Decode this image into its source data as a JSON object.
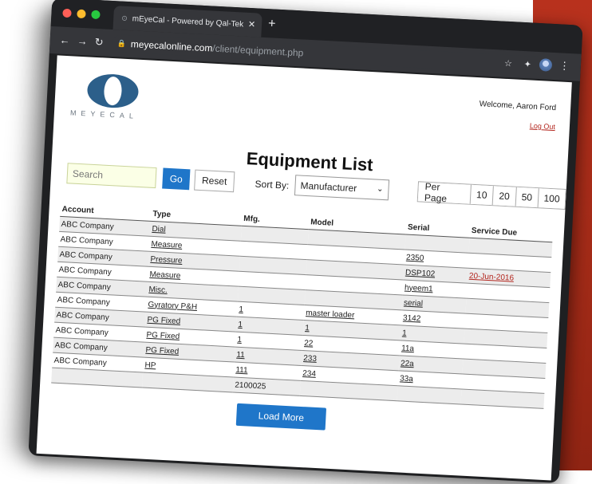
{
  "browser": {
    "tab_title": "mEyeCal - Powered by Qal-Tek",
    "url_host": "meyecalonline.com",
    "url_path": "/client/equipment.php"
  },
  "header": {
    "logo_text": "MEYECAL",
    "welcome": "Welcome, Aaron Ford",
    "logout": "Log Out"
  },
  "page": {
    "title": "Equipment List"
  },
  "controls": {
    "search_placeholder": "Search",
    "go": "Go",
    "reset": "Reset",
    "sort_label": "Sort By:",
    "sort_value": "Manufacturer",
    "per_page_label": "Per Page",
    "per_page_options": [
      "10",
      "20",
      "50",
      "100"
    ]
  },
  "table": {
    "headers": [
      "Account",
      "Type",
      "Mfg.",
      "Model",
      "Serial",
      "Service Due"
    ],
    "rows": [
      [
        "ABC Company",
        "Dial",
        "",
        "",
        "",
        ""
      ],
      [
        "ABC Company",
        "Measure",
        "",
        "",
        "2350",
        ""
      ],
      [
        "ABC Company",
        "Pressure",
        "",
        "",
        "DSP102",
        "20-Jun-2016"
      ],
      [
        "ABC Company",
        "Measure",
        "",
        "",
        "hyeem1",
        ""
      ],
      [
        "ABC Company",
        "Misc.",
        "",
        "",
        "serial",
        ""
      ],
      [
        "ABC Company",
        "Gyratory P&H",
        "1",
        "master loader",
        "3142",
        ""
      ],
      [
        "ABC Company",
        "PG Fixed",
        "1",
        "1",
        "1",
        ""
      ],
      [
        "ABC Company",
        "PG Fixed",
        "1",
        "22",
        "11a",
        ""
      ],
      [
        "ABC Company",
        "PG Fixed",
        "11",
        "233",
        "22a",
        ""
      ],
      [
        "ABC Company",
        "HP",
        "111",
        "234",
        "33a",
        ""
      ],
      [
        "",
        "",
        "2100025",
        "",
        "",
        ""
      ]
    ]
  },
  "footer": {
    "load_more": "Load More"
  }
}
